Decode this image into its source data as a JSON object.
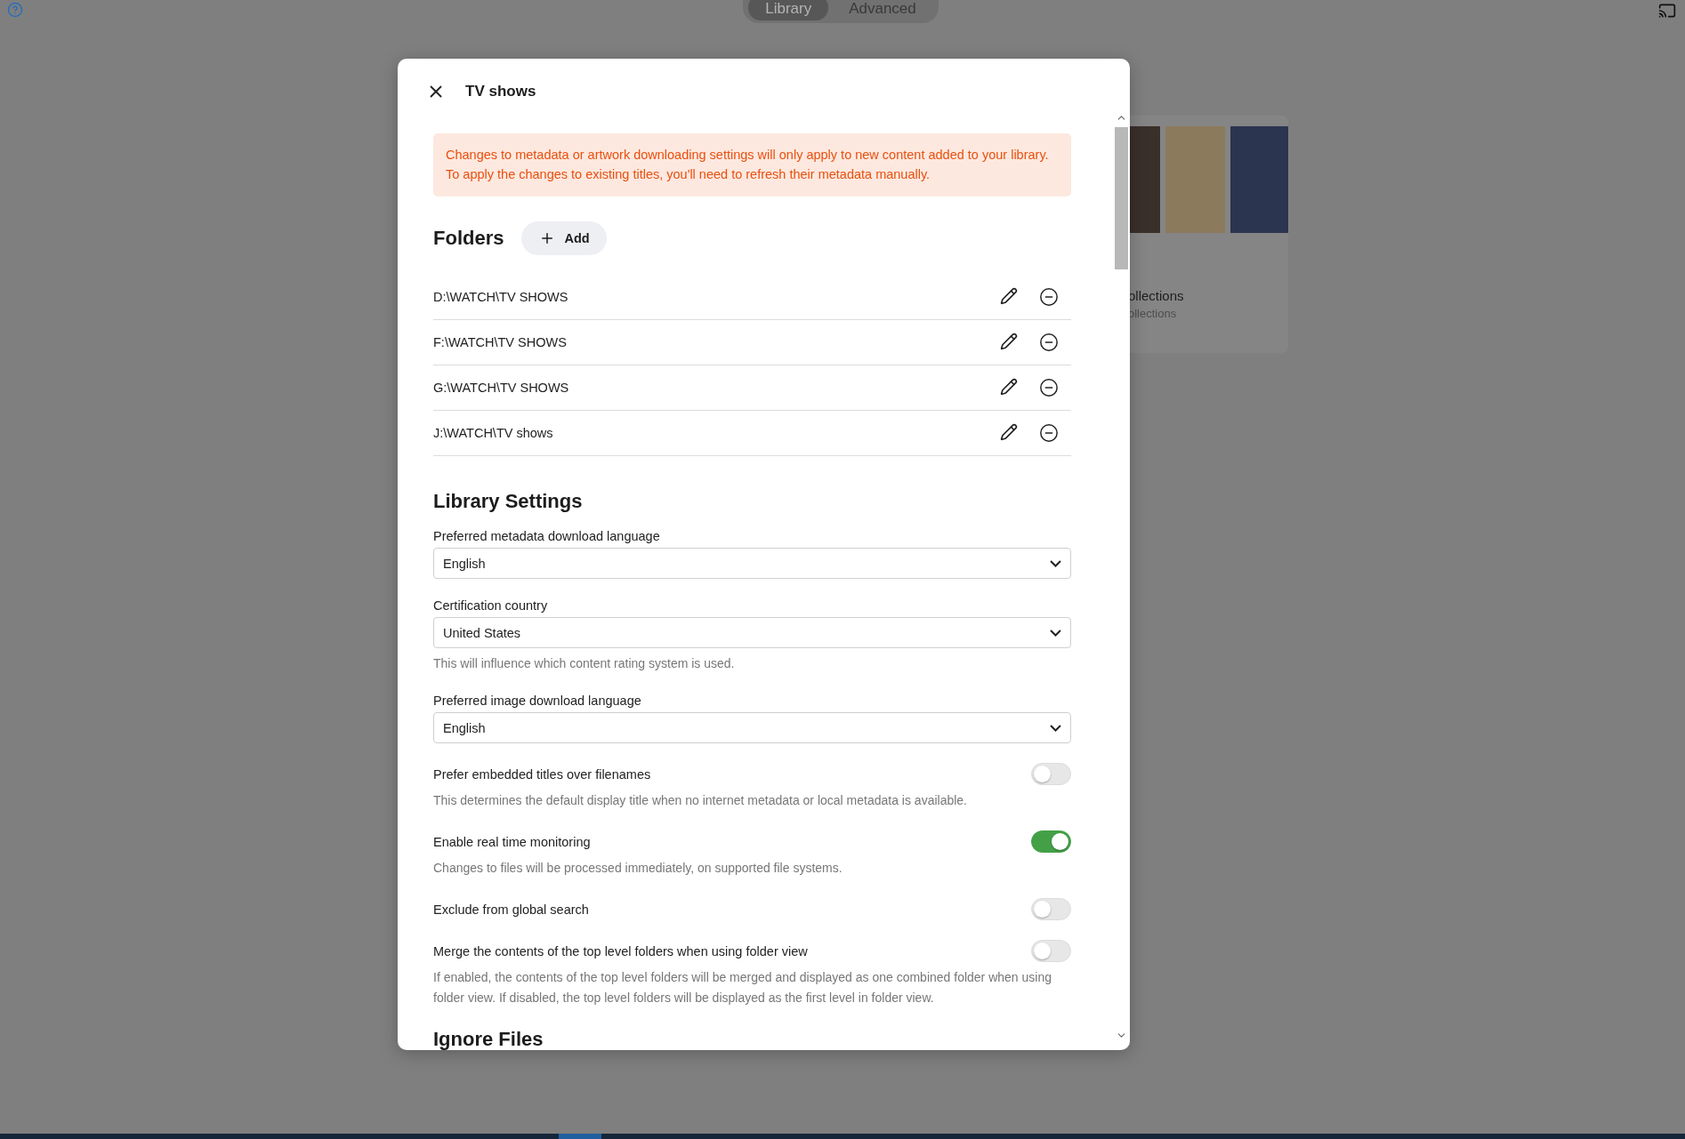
{
  "background": {
    "tabs": [
      {
        "label": "Library",
        "selected": true
      },
      {
        "label": "Advanced",
        "selected": false
      }
    ],
    "card": {
      "title": "ollections",
      "subtitle": "ollections"
    }
  },
  "dialog": {
    "title": "TV shows",
    "notice": "Changes to metadata or artwork downloading settings will only apply to new content added to your library. To apply the changes to existing titles, you'll need to refresh their metadata manually.",
    "folders": {
      "heading": "Folders",
      "add_label": "Add",
      "items": [
        {
          "path": "D:\\WATCH\\TV SHOWS"
        },
        {
          "path": "F:\\WATCH\\TV SHOWS"
        },
        {
          "path": "G:\\WATCH\\TV SHOWS"
        },
        {
          "path": "J:\\WATCH\\TV shows"
        }
      ]
    },
    "library_settings": {
      "heading": "Library Settings",
      "selects": [
        {
          "label": "Preferred metadata download language",
          "value": "English"
        },
        {
          "label": "Certification country",
          "value": "United States",
          "description": "This will influence which content rating system is used."
        },
        {
          "label": "Preferred image download language",
          "value": "English"
        }
      ],
      "toggles": [
        {
          "label": "Prefer embedded titles over filenames",
          "on": false,
          "description": "This determines the default display title when no internet metadata or local metadata is available."
        },
        {
          "label": "Enable real time monitoring",
          "on": true,
          "description": "Changes to files will be processed immediately, on supported file systems."
        },
        {
          "label": "Exclude from global search",
          "on": false
        },
        {
          "label": "Merge the contents of the top level folders when using folder view",
          "on": false,
          "description": "If enabled, the contents of the top level folders will be merged and displayed as one combined folder when using folder view. If disabled, the top level folders will be displayed as the first level in folder view."
        }
      ]
    },
    "next_heading": "Ignore Files"
  }
}
